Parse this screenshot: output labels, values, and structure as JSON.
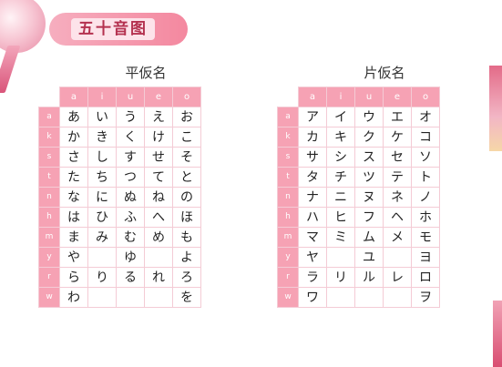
{
  "banner": {
    "title": "五十音图"
  },
  "hiragana": {
    "title": "平仮名",
    "vowels": [
      "a",
      "i",
      "u",
      "e",
      "o"
    ],
    "rows": [
      {
        "c": "a",
        "cells": [
          "あ",
          "い",
          "う",
          "え",
          "お"
        ]
      },
      {
        "c": "k",
        "cells": [
          "か",
          "き",
          "く",
          "け",
          "こ"
        ]
      },
      {
        "c": "s",
        "cells": [
          "さ",
          "し",
          "す",
          "せ",
          "そ"
        ]
      },
      {
        "c": "t",
        "cells": [
          "た",
          "ち",
          "つ",
          "て",
          "と"
        ]
      },
      {
        "c": "n",
        "cells": [
          "な",
          "に",
          "ぬ",
          "ね",
          "の"
        ]
      },
      {
        "c": "h",
        "cells": [
          "は",
          "ひ",
          "ふ",
          "へ",
          "ほ"
        ]
      },
      {
        "c": "m",
        "cells": [
          "ま",
          "み",
          "む",
          "め",
          "も"
        ]
      },
      {
        "c": "y",
        "cells": [
          "や",
          "",
          "ゆ",
          "",
          "よ"
        ]
      },
      {
        "c": "r",
        "cells": [
          "ら",
          "り",
          "る",
          "れ",
          "ろ"
        ]
      },
      {
        "c": "w",
        "cells": [
          "わ",
          "",
          "",
          "",
          "を"
        ]
      }
    ]
  },
  "katakana": {
    "title": "片仮名",
    "vowels": [
      "a",
      "i",
      "u",
      "e",
      "o"
    ],
    "rows": [
      {
        "c": "a",
        "cells": [
          "ア",
          "イ",
          "ウ",
          "エ",
          "オ"
        ]
      },
      {
        "c": "k",
        "cells": [
          "カ",
          "キ",
          "ク",
          "ケ",
          "コ"
        ]
      },
      {
        "c": "s",
        "cells": [
          "サ",
          "シ",
          "ス",
          "セ",
          "ソ"
        ]
      },
      {
        "c": "t",
        "cells": [
          "タ",
          "チ",
          "ツ",
          "テ",
          "ト"
        ]
      },
      {
        "c": "n",
        "cells": [
          "ナ",
          "ニ",
          "ヌ",
          "ネ",
          "ノ"
        ]
      },
      {
        "c": "h",
        "cells": [
          "ハ",
          "ヒ",
          "フ",
          "ヘ",
          "ホ"
        ]
      },
      {
        "c": "m",
        "cells": [
          "マ",
          "ミ",
          "ム",
          "メ",
          "モ"
        ]
      },
      {
        "c": "y",
        "cells": [
          "ヤ",
          "",
          "ユ",
          "",
          "ヨ"
        ]
      },
      {
        "c": "r",
        "cells": [
          "ラ",
          "リ",
          "ル",
          "レ",
          "ロ"
        ]
      },
      {
        "c": "w",
        "cells": [
          "ワ",
          "",
          "",
          "",
          "ヲ"
        ]
      }
    ]
  }
}
